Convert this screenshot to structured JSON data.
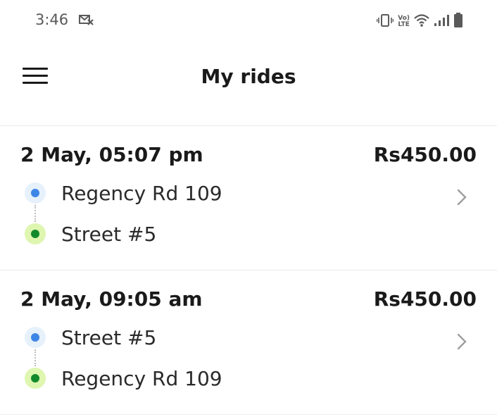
{
  "status_bar": {
    "time": "3:46",
    "volte_top": "Vo)",
    "volte_bottom": "LTE",
    "icons": [
      "envelope-x-icon",
      "vibrate-icon",
      "volte-icon",
      "wifi-icon",
      "signal-icon",
      "battery-icon"
    ]
  },
  "header": {
    "title": "My rides",
    "menu_icon": "hamburger-menu-icon"
  },
  "rides": [
    {
      "datetime": "2 May, 05:07 pm",
      "price": "Rs450.00",
      "pickup": "Regency Rd 109",
      "dropoff": "Street #5"
    },
    {
      "datetime": "2 May, 09:05 am",
      "price": "Rs450.00",
      "pickup": "Street #5",
      "dropoff": "Regency Rd 109"
    }
  ],
  "colors": {
    "pickup_dot": "#3d86e6",
    "pickup_halo": "#e6f1fb",
    "dropoff_dot": "#128a2c",
    "dropoff_halo": "#def6b0",
    "divider": "#ececec"
  }
}
